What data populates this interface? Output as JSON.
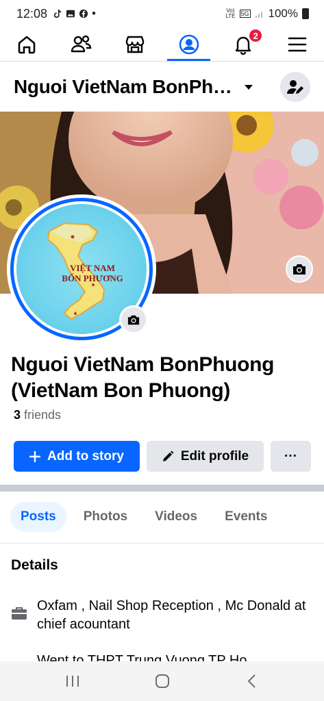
{
  "status_bar": {
    "time": "12:08",
    "dot": "•",
    "network_top": "Vo)",
    "network_bottom": "LTE",
    "signal_label": "5G",
    "battery": "100%"
  },
  "nav": {
    "notification_count": "2",
    "items": [
      "home-icon",
      "friends-icon",
      "marketplace-icon",
      "profile-icon",
      "bell-icon",
      "menu-icon"
    ]
  },
  "header": {
    "title": "Nguoi VietNam BonPh…"
  },
  "avatar": {
    "map_title_line1": "VIỆT NAM",
    "map_title_line2": "BỐN PHƯƠNG"
  },
  "profile": {
    "name": "Nguoi VietNam BonPhuong (VietNam Bon Phuong)",
    "friends_count": "3",
    "friends_label": "friends"
  },
  "actions": {
    "add_story": "Add to story",
    "edit_profile": "Edit profile",
    "more": "···"
  },
  "tabs": [
    "Posts",
    "Photos",
    "Videos",
    "Events"
  ],
  "details": {
    "title": "Details",
    "work": "Oxfam , Nail Shop Reception , Mc Donald at chief acountant",
    "education": "Went to THPT Trung Vuong TP Ho"
  },
  "colors": {
    "accent": "#0866ff",
    "badge": "#e41e3f"
  }
}
